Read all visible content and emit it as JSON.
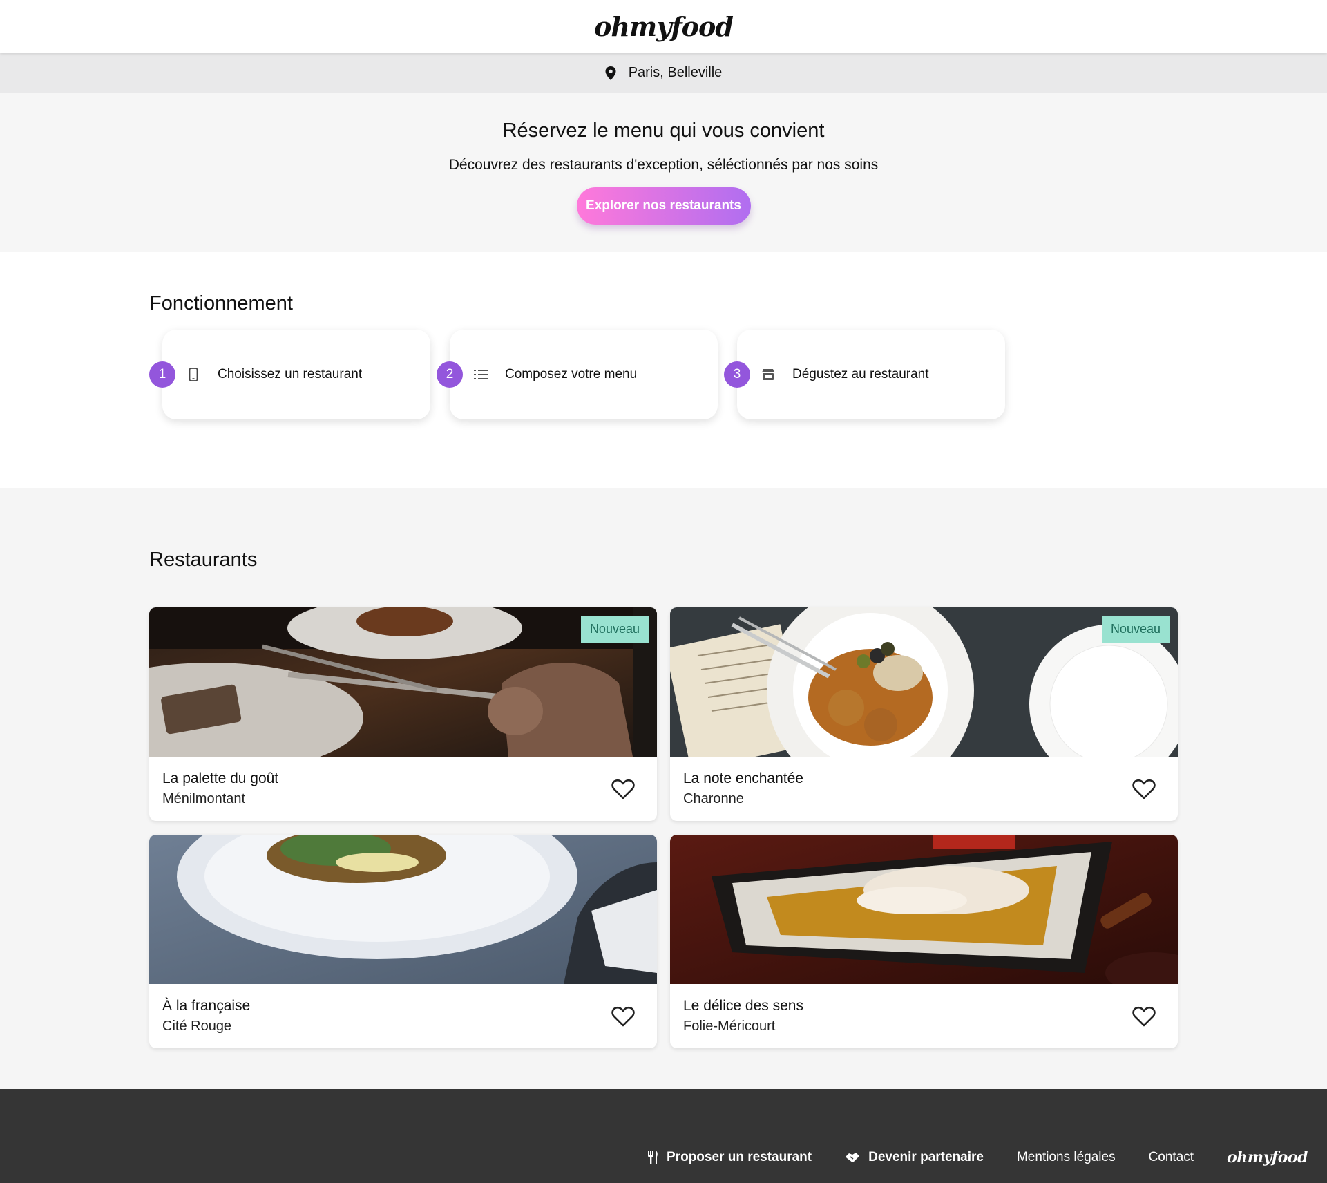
{
  "header": {
    "logo": "ohmyfood"
  },
  "location": {
    "text": "Paris, Belleville",
    "icon": "map-pin-icon"
  },
  "hero": {
    "title": "Réservez le menu qui vous convient",
    "subtitle": "Découvrez des restaurants d'exception, séléctionnés par nos soins",
    "cta_label": "Explorer nos restaurants"
  },
  "how": {
    "title": "Fonctionnement",
    "steps": [
      {
        "number": "1",
        "icon": "mobile-phone-icon",
        "label": "Choisissez un restaurant"
      },
      {
        "number": "2",
        "icon": "list-icon",
        "label": "Composez votre menu"
      },
      {
        "number": "3",
        "icon": "store-icon",
        "label": "Dégustez au restaurant"
      }
    ]
  },
  "restaurants": {
    "title": "Restaurants",
    "items": [
      {
        "name": "La palette du goût",
        "area": "Ménilmontant",
        "badge": "Nouveau"
      },
      {
        "name": "La note enchantée",
        "area": "Charonne",
        "badge": "Nouveau"
      },
      {
        "name": "À la française",
        "area": "Cité Rouge",
        "badge": ""
      },
      {
        "name": "Le délice des sens",
        "area": "Folie-Méricourt",
        "badge": ""
      }
    ]
  },
  "footer": {
    "links": [
      {
        "label": "Proposer un restaurant",
        "icon": "utensils-icon"
      },
      {
        "label": "Devenir partenaire",
        "icon": "handshake-icon"
      },
      {
        "label": "Mentions légales"
      },
      {
        "label": "Contact"
      }
    ],
    "logo": "ohmyfood"
  },
  "colors": {
    "accent": "#9356dc",
    "cta_gradient_start": "#ff79da",
    "cta_gradient_end": "#b06ef0",
    "badge_bg": "#99e2d0",
    "footer_bg": "#353535"
  }
}
